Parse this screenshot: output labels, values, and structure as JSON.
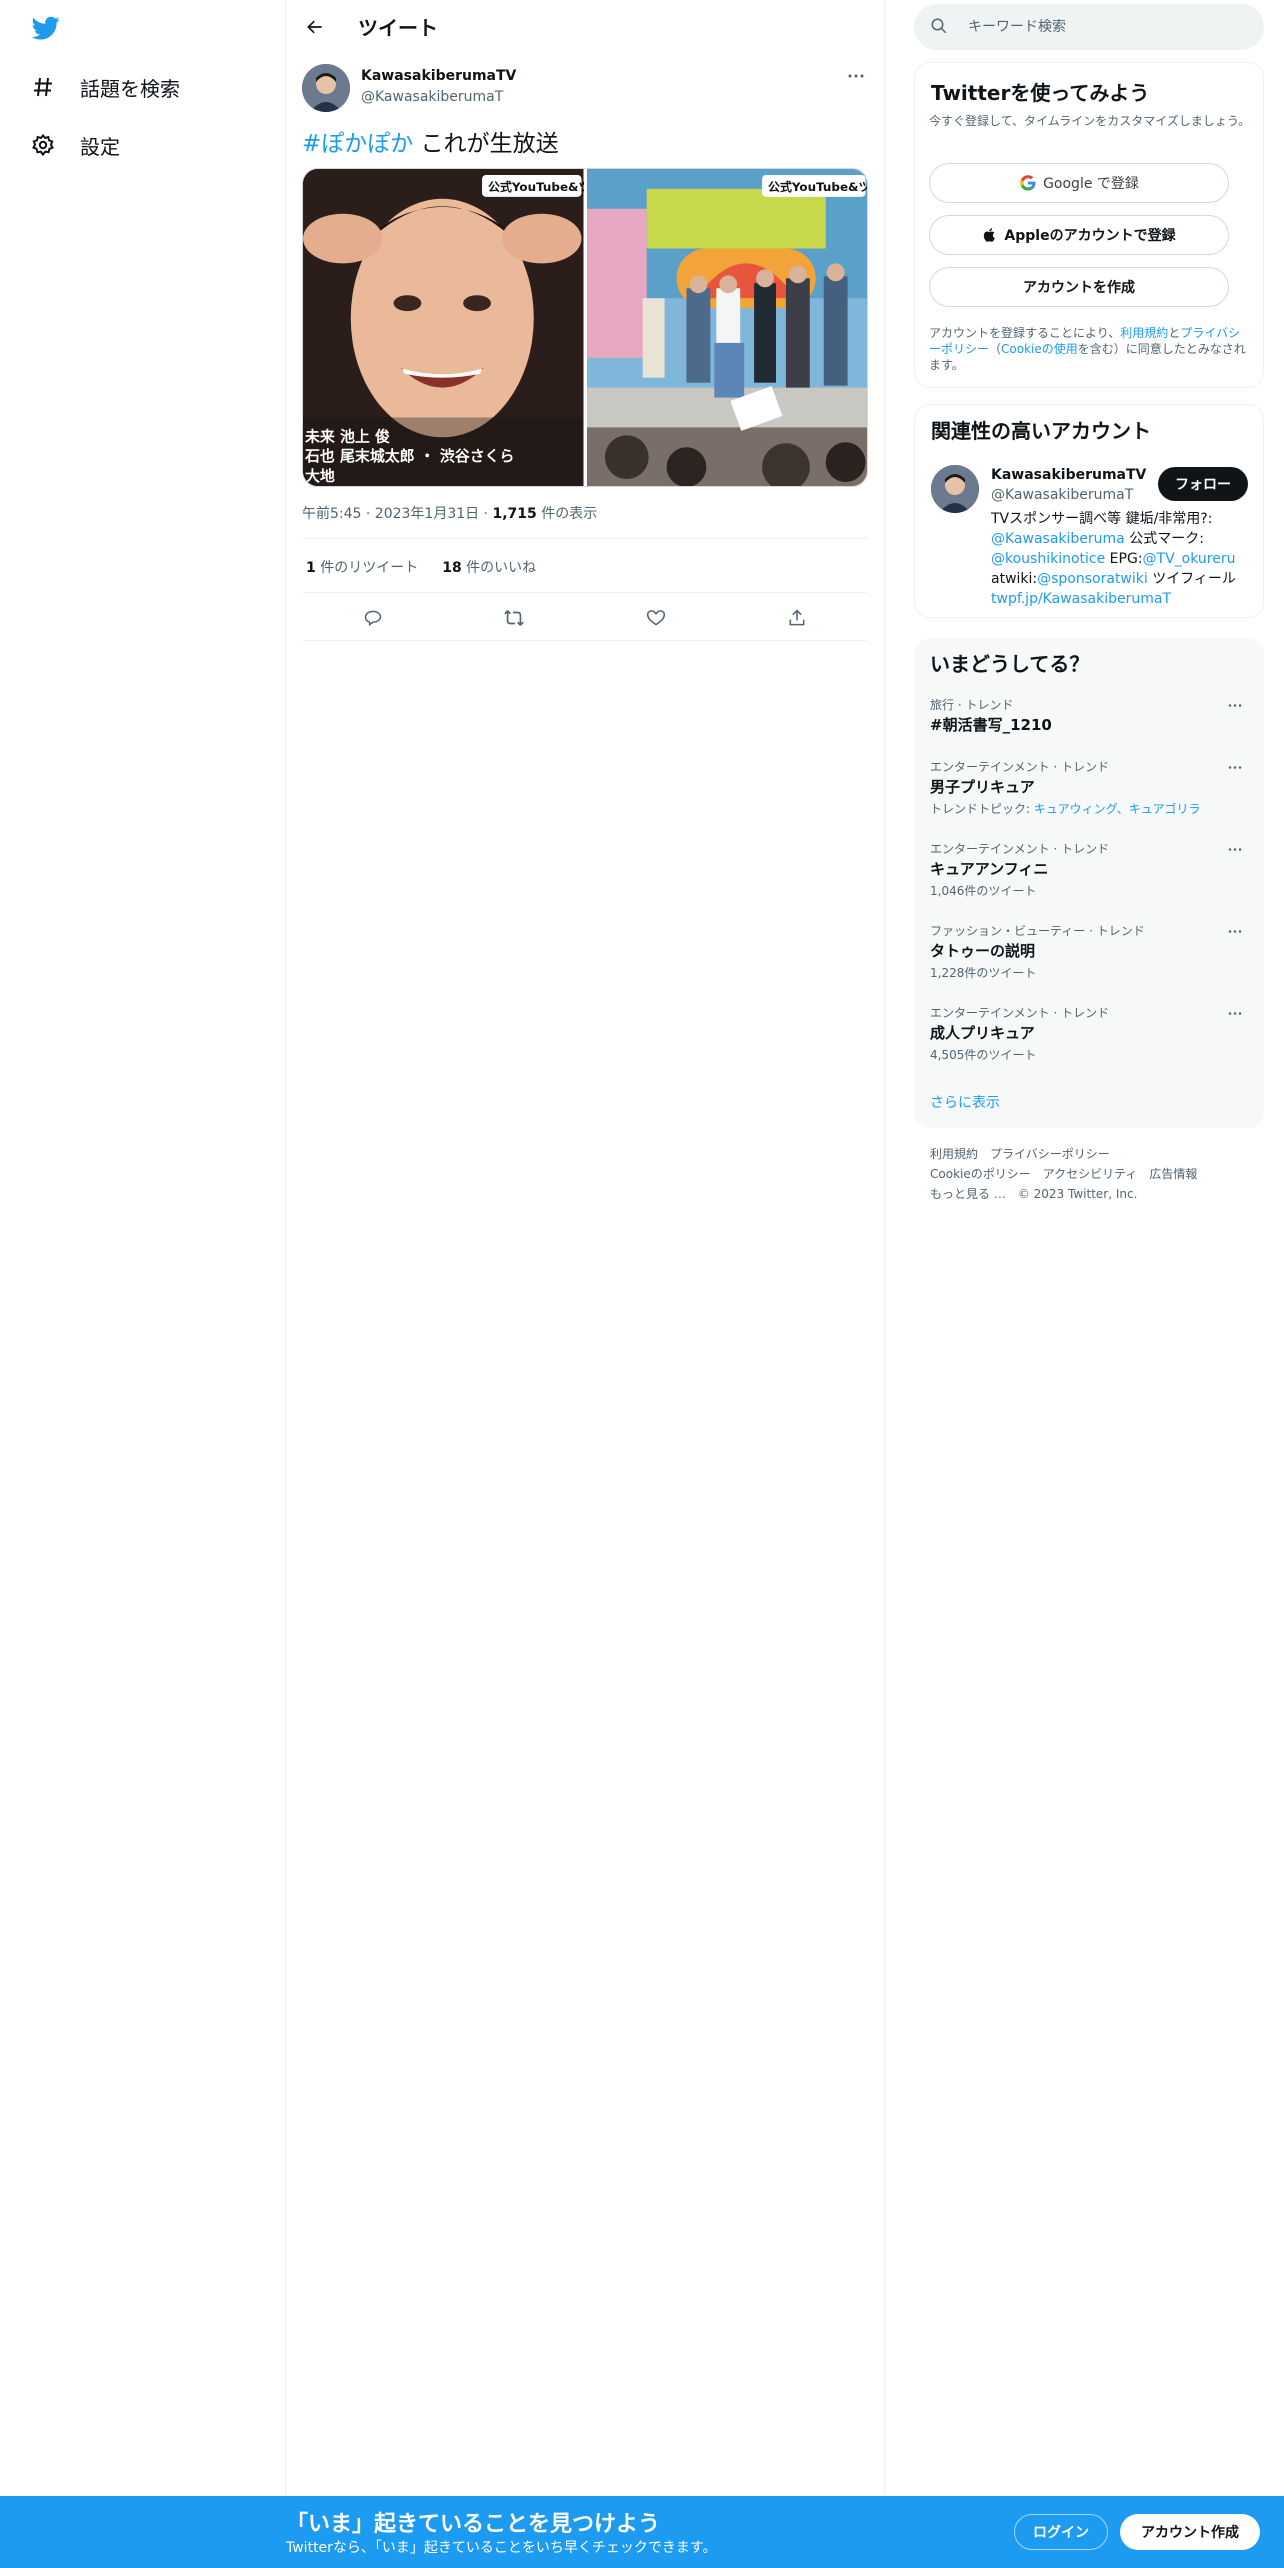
{
  "nav": {
    "logo": "twitter-bird-icon",
    "items": [
      {
        "label": "話題を検索",
        "icon": "hashtag-icon"
      },
      {
        "label": "設定",
        "icon": "gear-icon"
      }
    ]
  },
  "header": {
    "title": "ツイート"
  },
  "tweet": {
    "name": "KawasakiberumaTV",
    "handle": "@KawasakiberumaT",
    "hashtag": "#ぽかぽか",
    "text": " これが生放送",
    "media_caption_left": "公式YouTube&ツイ",
    "media_caption_right": "公式YouTube&ツイ",
    "media_subtitle_lines": [
      "未来 池上 俊",
      "石也 尾末城太郎 ・ 渋谷さくら",
      "大地"
    ],
    "meta_time": "午前5:45 · 2023年1月31日 · ",
    "meta_views_count": "1,715",
    "meta_views_label": " 件の表示",
    "retweets_count": "1",
    "retweets_label": " 件のリツイート",
    "likes_count": "18",
    "likes_label": " 件のいいね"
  },
  "search": {
    "placeholder": "キーワード検索"
  },
  "signup": {
    "title": "Twitterを使ってみよう",
    "subtitle": "今すぐ登録して、タイムラインをカスタマイズしましょう。",
    "google_label": "Google で登録",
    "apple_label": "Appleのアカウントで登録",
    "create_label": "アカウントを作成",
    "legal_prefix": "アカウントを登録することにより、",
    "legal_terms": "利用規約",
    "legal_and": "と",
    "legal_privacy": "プライバシーポリシー",
    "legal_paren_open": "（",
    "legal_cookie": "Cookieの使用",
    "legal_suffix": "を含む）に同意したとみなされます。"
  },
  "related": {
    "title": "関連性の高いアカウント",
    "name": "KawasakiberumaTV",
    "handle": "@KawasakiberumaT",
    "follow_label": "フォロー",
    "bio_1": "TVスポンサー調べ等 鍵垢/非常用?: ",
    "bio_link_1": "@Kawasakiberuma",
    "bio_2": " 公式マーク: ",
    "bio_link_2": "@koushikinotice",
    "bio_3": " EPG:",
    "bio_link_3": "@TV_okureru",
    "bio_4": " atwiki:",
    "bio_link_4": "@sponsoratwiki",
    "bio_5": " ツイフィール ",
    "bio_link_5": "twpf.jp/KawasakiberumaT"
  },
  "trends": {
    "title": "いまどうしてる？",
    "items": [
      {
        "category": "旅行 · トレンド",
        "name": "#朝活書写_1210",
        "sub": ""
      },
      {
        "category": "エンターテインメント · トレンド",
        "name": "男子プリキュア",
        "sub_prefix": "トレンドトピック: ",
        "sub_links": "キュアウィング、キュアゴリラ"
      },
      {
        "category": "エンターテインメント · トレンド",
        "name": "キュアアンフィニ",
        "sub": "1,046件のツイート"
      },
      {
        "category": "ファッション・ビューティー · トレンド",
        "name": "タトゥーの説明",
        "sub": "1,228件のツイート"
      },
      {
        "category": "エンターテインメント · トレンド",
        "name": "成人プリキュア",
        "sub": "4,505件のツイート"
      }
    ],
    "show_more": "さらに表示"
  },
  "footer": {
    "links": [
      "利用規約",
      "プライバシーポリシー",
      "Cookieのポリシー",
      "アクセシビリティ",
      "広告情報",
      "もっと見る …",
      "© 2023 Twitter, Inc."
    ]
  },
  "bottom_bar": {
    "title": "「いま」起きていることを見つけよう",
    "subtitle": "Twitterなら、「いま」起きていることをいち早くチェックできます。",
    "login_label": "ログイン",
    "signup_label": "アカウント作成"
  },
  "colors": {
    "accent": "#1d9bf0",
    "text": "#0f1419",
    "secondary": "#536471"
  }
}
